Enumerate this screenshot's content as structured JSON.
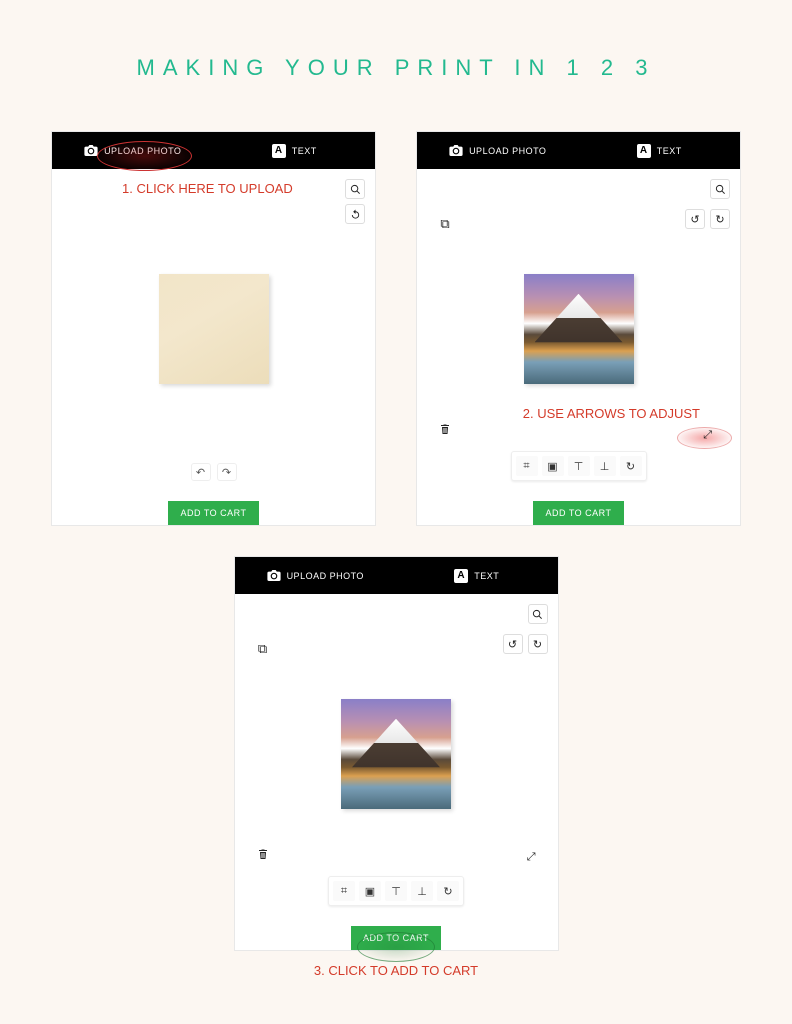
{
  "title": "MAKING YOUR PRINT IN 1 2 3",
  "header": {
    "upload_label": "UPLOAD PHOTO",
    "text_label": "TEXT"
  },
  "add_to_cart_label": "ADD TO CART",
  "annotations": {
    "step1": "1. CLICK HERE TO UPLOAD",
    "step2": "2. USE ARROWS TO ADJUST",
    "step3": "3. CLICK TO ADD TO CART"
  }
}
